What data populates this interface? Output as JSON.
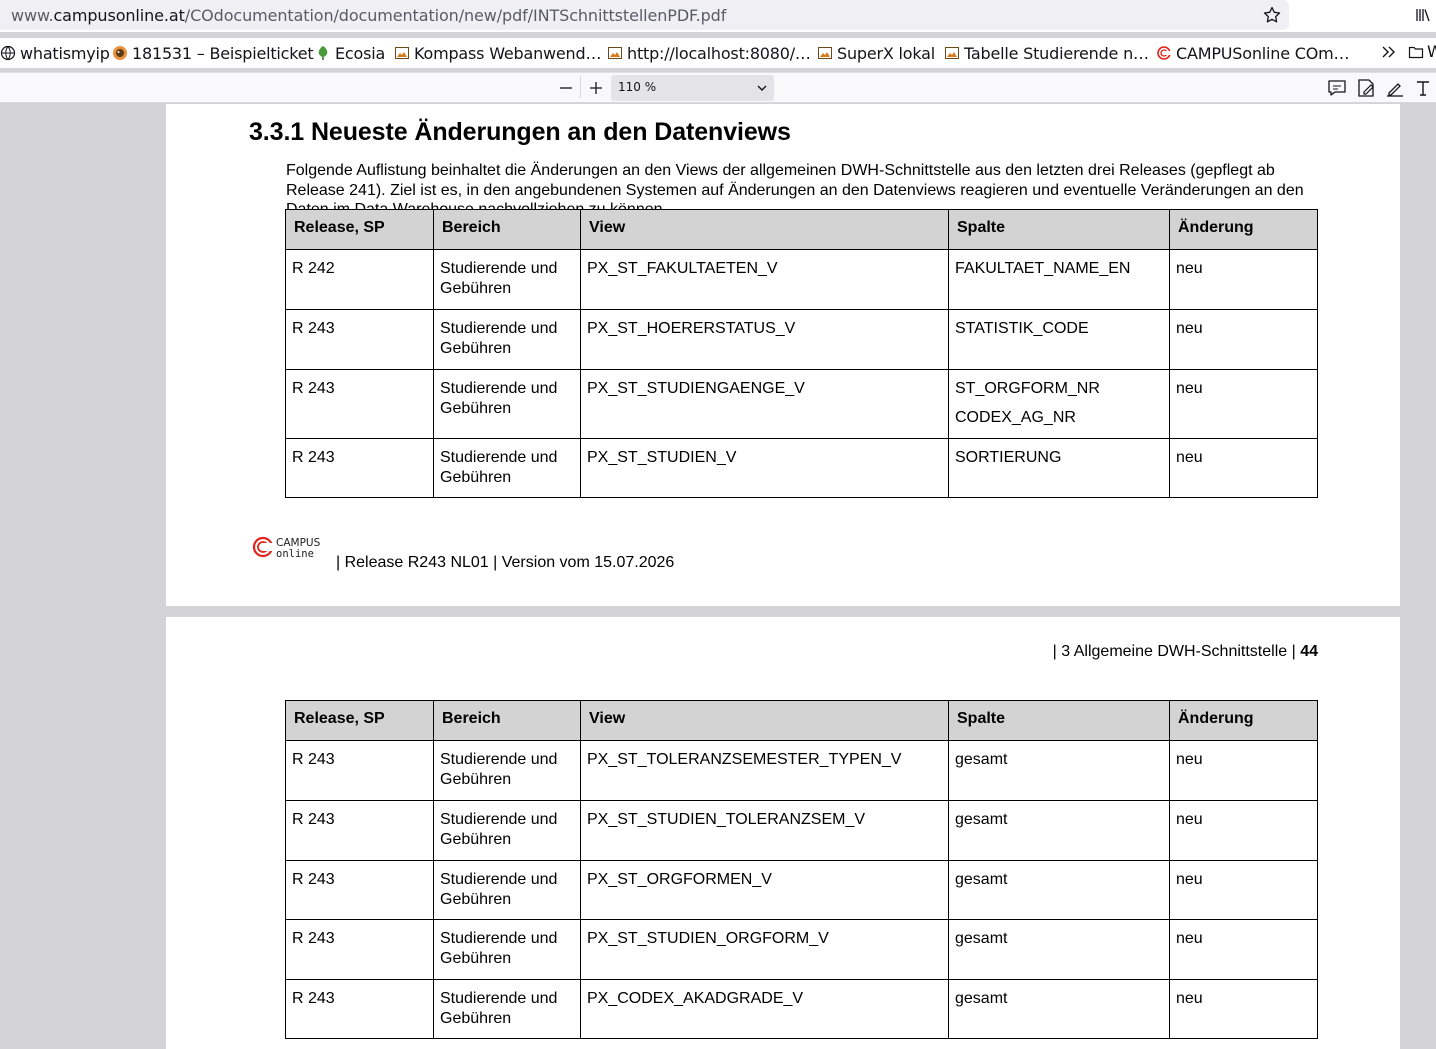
{
  "browser": {
    "url_host": "www.campusonline.at",
    "url_path": "/COdocumentation/documentation/new/pdf/INTSchnittstellenPDF.pdf",
    "url_prefix": "www.",
    "url_domain": "campusonline.at",
    "bookmarks": [
      {
        "label": "whatismyip",
        "icon": "globe-icon"
      },
      {
        "label": "181531 – Beispielticket",
        "icon": "bug-icon"
      },
      {
        "label": "Ecosia",
        "icon": "ecosia-icon"
      },
      {
        "label": "Kompass Webanwend…",
        "icon": "image-icon"
      },
      {
        "label": "http://localhost:8080/…",
        "icon": "image-icon"
      },
      {
        "label": "SuperX lokal",
        "icon": "image-icon"
      },
      {
        "label": "Tabelle Studierende n…",
        "icon": "image-icon"
      },
      {
        "label": "CAMPUSonline COm…",
        "icon": "campusonline-icon"
      }
    ],
    "bookmarks_folder_label": "W"
  },
  "pdf_toolbar": {
    "zoom": "110 %"
  },
  "page1": {
    "heading": "3.3.1 Neueste Änderungen an den Datenviews",
    "intro": "Folgende Auflistung beinhaltet die Änderungen an den Views der allgemeinen DWH-Schnittstelle aus den letzten drei Releases (gepflegt ab Release 241). Ziel ist es, in den angebundenen Systemen auf Änderungen an den Datenviews reagieren und eventuelle Veränderungen an den Daten im Data Warehouse nachvollziehen zu können.",
    "table": {
      "headers": [
        "Release, SP",
        "Bereich",
        "View",
        "Spalte",
        "Änderung"
      ],
      "rows": [
        {
          "release": "R 242",
          "bereich": "Studierende und Gebühren",
          "view": "PX_ST_FAKULTAETEN_V",
          "spalte": [
            "FAKULTAET_NAME_EN"
          ],
          "aenderung": "neu"
        },
        {
          "release": "R 243",
          "bereich": "Studierende und Gebühren",
          "view": "PX_ST_HOERERSTATUS_V",
          "spalte": [
            "STATISTIK_CODE"
          ],
          "aenderung": "neu"
        },
        {
          "release": "R 243",
          "bereich": "Studierende und Gebühren",
          "view": "PX_ST_STUDIENGAENGE_V",
          "spalte": [
            "ST_ORGFORM_NR",
            "CODEX_AG_NR"
          ],
          "aenderung": "neu"
        },
        {
          "release": "R 243",
          "bereich": "Studierende und Gebühren",
          "view": "PX_ST_STUDIEN_V",
          "spalte": [
            "SORTIERUNG"
          ],
          "aenderung": "neu"
        }
      ]
    },
    "footer_logo_top": "CAMPUS",
    "footer_logo_bottom": "online",
    "footer": "| Release R243 NL01 | Version vom 15.07.2026"
  },
  "page2": {
    "header_section": "| 3 Allgemeine DWH-Schnittstelle |",
    "page_number": "44",
    "table": {
      "headers": [
        "Release, SP",
        "Bereich",
        "View",
        "Spalte",
        "Änderung"
      ],
      "rows": [
        {
          "release": "R 243",
          "bereich": "Studierende und Gebühren",
          "view": "PX_ST_TOLERANZSEMESTER_TYPEN_V",
          "spalte": [
            "gesamt"
          ],
          "aenderung": "neu"
        },
        {
          "release": "R 243",
          "bereich": "Studierende und Gebühren",
          "view": "PX_ST_STUDIEN_TOLERANZSEM_V",
          "spalte": [
            "gesamt"
          ],
          "aenderung": "neu"
        },
        {
          "release": "R 243",
          "bereich": "Studierende und Gebühren",
          "view": "PX_ST_ORGFORMEN_V",
          "spalte": [
            "gesamt"
          ],
          "aenderung": "neu"
        },
        {
          "release": "R 243",
          "bereich": "Studierende und Gebühren",
          "view": "PX_ST_STUDIEN_ORGFORM_V",
          "spalte": [
            "gesamt"
          ],
          "aenderung": "neu"
        },
        {
          "release": "R 243",
          "bereich": "Studierende und Gebühren",
          "view": "PX_CODEX_AKADGRADE_V",
          "spalte": [
            "gesamt"
          ],
          "aenderung": "neu"
        }
      ]
    }
  },
  "colors": {
    "campusonline_red": "#e2231a",
    "table_header_bg": "#d3d3d3",
    "viewer_bg": "#d4d4d7"
  }
}
